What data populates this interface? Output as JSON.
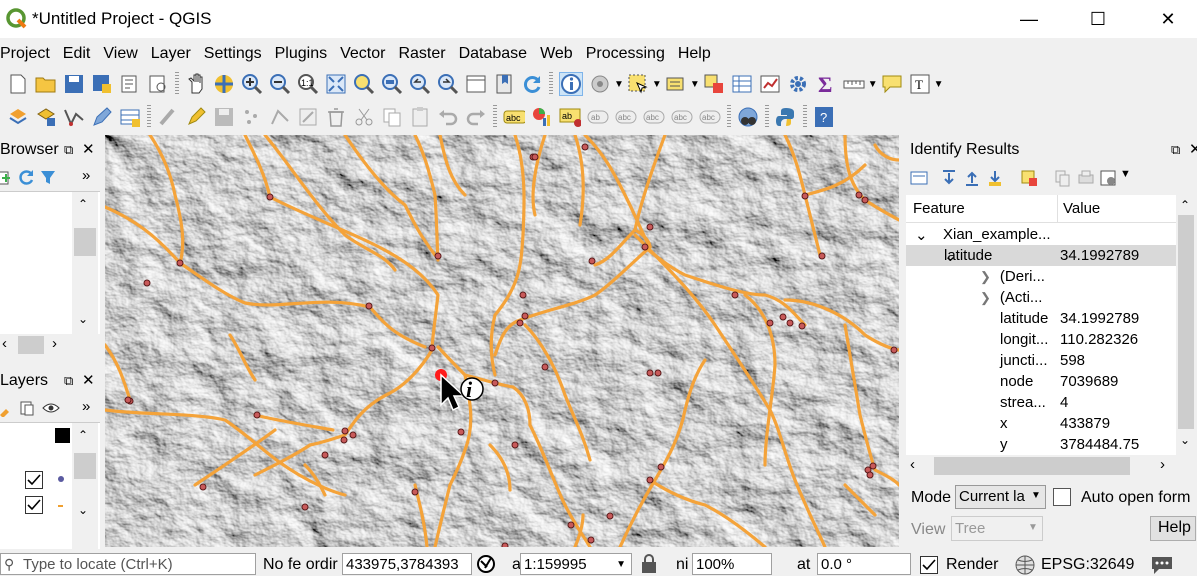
{
  "window": {
    "title": "*Untitled Project - QGIS"
  },
  "menu": [
    "Project",
    "Edit",
    "View",
    "Layer",
    "Settings",
    "Plugins",
    "Vector",
    "Raster",
    "Database",
    "Web",
    "Processing",
    "Help"
  ],
  "browser_panel": {
    "title": "Browser"
  },
  "layers_panel": {
    "title": "Layers"
  },
  "identify": {
    "title": "Identify Results",
    "col_feature": "Feature",
    "col_value": "Value",
    "rows": [
      {
        "label": "Xian_example...",
        "value": ""
      },
      {
        "label": "latitude",
        "value": "34.1992789"
      },
      {
        "label": "(Deri...",
        "value": ""
      },
      {
        "label": "(Acti...",
        "value": ""
      },
      {
        "label": "latitude",
        "value": "34.1992789"
      },
      {
        "label": "longit...",
        "value": "110.282326"
      },
      {
        "label": "juncti...",
        "value": "598"
      },
      {
        "label": "node",
        "value": "7039689"
      },
      {
        "label": "strea...",
        "value": "4"
      },
      {
        "label": "x",
        "value": "433879"
      },
      {
        "label": "y",
        "value": "3784484.75"
      }
    ],
    "mode_label": "Mode",
    "mode_value": "Current la",
    "auto_open_label": "Auto open form",
    "view_label": "View",
    "view_value": "Tree",
    "help_label": "Help"
  },
  "status": {
    "locate_placeholder": "Type to locate (Ctrl+K)",
    "coord_label": "No fe ordir",
    "coordinate": "433975,3784393",
    "scale_label": "a",
    "scale": "1:159995",
    "magnifier_label": "ni",
    "magnifier": "100%",
    "rotation_label": "at",
    "rotation": "0.0 °",
    "render_label": "Render",
    "crs": "EPSG:32649"
  }
}
